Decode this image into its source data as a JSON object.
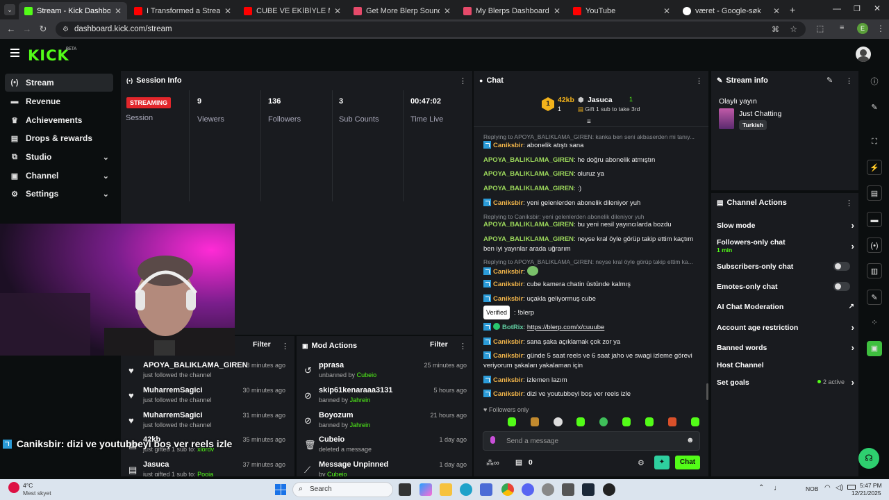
{
  "browser": {
    "tabs": [
      {
        "title": "Stream - Kick Dashboard",
        "color": "#53fc18",
        "active": true
      },
      {
        "title": "I Transformed a Streamer's Life",
        "color": "#ff0000"
      },
      {
        "title": "CUBE VE EKİBİYLE MİMESİS'TE",
        "color": "#ff0000"
      },
      {
        "title": "Get More Blerp Sound Beets!",
        "color": "#e64a6a"
      },
      {
        "title": "My Blerps Dashboard",
        "color": "#e64a6a"
      },
      {
        "title": "YouTube",
        "color": "#ff0000"
      },
      {
        "title": "været - Google-søk",
        "color": "#ffffff"
      }
    ],
    "url": "dashboard.kick.com/stream",
    "profile_initial": "E"
  },
  "header": {
    "logo": "KICK",
    "beta": "BETA"
  },
  "sidebar": {
    "items": [
      {
        "label": "Stream",
        "icon": "stream-icon",
        "glyph": "((•))"
      },
      {
        "label": "Revenue",
        "icon": "revenue-icon",
        "glyph": "▬"
      },
      {
        "label": "Achievements",
        "icon": "trophy-icon",
        "glyph": "🏆"
      },
      {
        "label": "Drops & rewards",
        "icon": "gift-icon",
        "glyph": "🎁"
      },
      {
        "label": "Studio",
        "icon": "studio-icon",
        "glyph": "⧉"
      },
      {
        "label": "Channel",
        "icon": "channel-icon",
        "glyph": "▣"
      },
      {
        "label": "Settings",
        "icon": "gear-icon",
        "glyph": "⚙"
      }
    ]
  },
  "session": {
    "title": "Session Info",
    "status": "STREAMING",
    "status_label": "Session",
    "stats": [
      {
        "value": "9",
        "label": "Viewers"
      },
      {
        "value": "136",
        "label": "Followers"
      },
      {
        "value": "3",
        "label": "Sub Counts"
      },
      {
        "value": "00:47:02",
        "label": "Time Live"
      }
    ]
  },
  "activity": {
    "filter": "Filter",
    "items": [
      {
        "name": "APOYA_BALIKLAMA_GIREN",
        "sub": "just followed the channel",
        "time": "8 minutes ago"
      },
      {
        "name": "MuharremSagici",
        "sub": "just followed the channel",
        "time": "30 minutes ago"
      },
      {
        "name": "MuharremSagici",
        "sub": "just followed the channel",
        "time": "31 minutes ago"
      },
      {
        "name": "42kb",
        "sub": "just gifted 1 sub to:",
        "sub_user": "xlordv",
        "time": "35 minutes ago"
      },
      {
        "name": "Jasuca",
        "sub": "just gifted 1 sub to:",
        "sub_user": "Pooja",
        "time": "37 minutes ago"
      }
    ]
  },
  "mod_actions": {
    "title": "Mod Actions",
    "filter": "Filter",
    "items": [
      {
        "name": "pprasa",
        "action": "unbanned by",
        "by": "Cubeio",
        "time": "25 minutes ago",
        "icon": "undo-icon"
      },
      {
        "name": "skip61kenaraaa3131",
        "action": "banned by",
        "by": "Jahrein",
        "time": "5 hours ago",
        "icon": "ban-icon"
      },
      {
        "name": "Boyozum",
        "action": "banned by",
        "by": "Jahrein",
        "time": "21 hours ago",
        "icon": "ban-icon"
      },
      {
        "name": "Cubeio",
        "action": "deleted a message",
        "by": "",
        "time": "1 day ago",
        "icon": "trash-icon"
      },
      {
        "name": "Message Unpinned",
        "action": "by",
        "by": "Cubeio",
        "time": "1 day ago",
        "icon": "unpin-icon"
      }
    ]
  },
  "chat": {
    "title": "Chat",
    "leaderboard": {
      "first": "42kb",
      "first_count": "1",
      "second": "Jasuca",
      "second_count": "1",
      "gift_hint": "Gift 1 sub to take 3rd"
    },
    "messages": [
      {
        "reply": "Replying to APOYA_BALIKLAMA_GIREN: kanka ben seni akbaserden mi tanıy..."
      },
      {
        "user": "Caniksbir",
        "text": "abonelik atıştı sana",
        "badge": true,
        "color": "orange"
      },
      {
        "user": "APOYA_BALIKLAMA_GIREN",
        "text": "he doğru abonelik atmıştın",
        "color": "green"
      },
      {
        "user": "APOYA_BALIKLAMA_GIREN",
        "text": "oluruz ya",
        "color": "green"
      },
      {
        "user": "APOYA_BALIKLAMA_GIREN",
        "text": ":)",
        "color": "green"
      },
      {
        "user": "Caniksbir",
        "text": "yeni gelenlerden abonelik dileniyor yuh",
        "badge": true,
        "color": "orange"
      },
      {
        "reply": "Replying to Caniksbir: yeni gelenlerden abonelik dileniyor yuh"
      },
      {
        "user": "APOYA_BALIKLAMA_GIREN",
        "text": "bu yeni nesil yayıncılarda bozdu",
        "color": "green"
      },
      {
        "user": "APOYA_BALIKLAMA_GIREN",
        "text": "neyse kral öyle görüp takip ettim kaçtım ben iyi yayınlar arada uğrarım",
        "color": "green"
      },
      {
        "reply": "Replying to APOYA_BALIKLAMA_GIREN: neyse kral öyle görüp takip ettim ka..."
      },
      {
        "user": "Caniksbir",
        "text": "",
        "badge": true,
        "color": "orange",
        "emote": true
      },
      {
        "user": "Caniksbir",
        "text": "cube kamera chatin üstünde kalmış",
        "badge": true,
        "color": "orange"
      },
      {
        "user": "Caniksbir",
        "text": "uçakla geliyormuş cube",
        "badge": true,
        "color": "orange"
      },
      {
        "user": "",
        "text": "!blerp",
        "color": "orange"
      },
      {
        "user": "BotRix",
        "text": "https://blerp.com/x/cuuube",
        "badge": true,
        "color": "teal",
        "link": true
      },
      {
        "user": "Caniksbir",
        "text": "sana şaka açıklamak çok zor ya",
        "badge": true,
        "color": "orange"
      },
      {
        "user": "Caniksbir",
        "text": "günde 5 saat reels ve 6 saat jaho ve swagi izleme görevi veriyorum şakaları yakalaman için",
        "badge": true,
        "color": "orange"
      },
      {
        "user": "Caniksbir",
        "text": "izlemen lazım",
        "badge": true,
        "color": "orange"
      },
      {
        "user": "Caniksbir",
        "text": "dizi ve youtubbeyi boş ver reels izle",
        "badge": true,
        "color": "orange"
      }
    ],
    "tooltip": "Verified",
    "mode": "Followers only",
    "input_placeholder": "Send a message",
    "points": "0",
    "send": "Chat"
  },
  "stream_info": {
    "title": "Stream info",
    "stream_title": "Olaylı yayın",
    "category": "Just Chatting",
    "tag": "Turkish"
  },
  "channel_actions": {
    "title": "Channel Actions",
    "items": [
      {
        "label": "Slow mode",
        "kind": "arrow"
      },
      {
        "label": "Followers-only chat",
        "sub": "1 min",
        "kind": "arrow"
      },
      {
        "label": "Subscribers-only chat",
        "kind": "toggle"
      },
      {
        "label": "Emotes-only chat",
        "kind": "toggle"
      },
      {
        "label": "AI Chat Moderation",
        "kind": "external"
      },
      {
        "label": "Account age restriction",
        "kind": "arrow"
      },
      {
        "label": "Banned words",
        "kind": "arrow"
      },
      {
        "label": "Host Channel",
        "kind": "none"
      },
      {
        "label": "Set goals",
        "sub": "2 active",
        "kind": "arrow"
      }
    ]
  },
  "overlay": {
    "user": "Caniksbir",
    "text": ": dizi ve youtubbeyi boş ver reels izle"
  },
  "taskbar": {
    "weather_temp": "4°C",
    "weather_desc": "Mest skyet",
    "search": "Search",
    "lang": "NOB",
    "time": "5:47 PM",
    "date": "12/21/2025"
  }
}
